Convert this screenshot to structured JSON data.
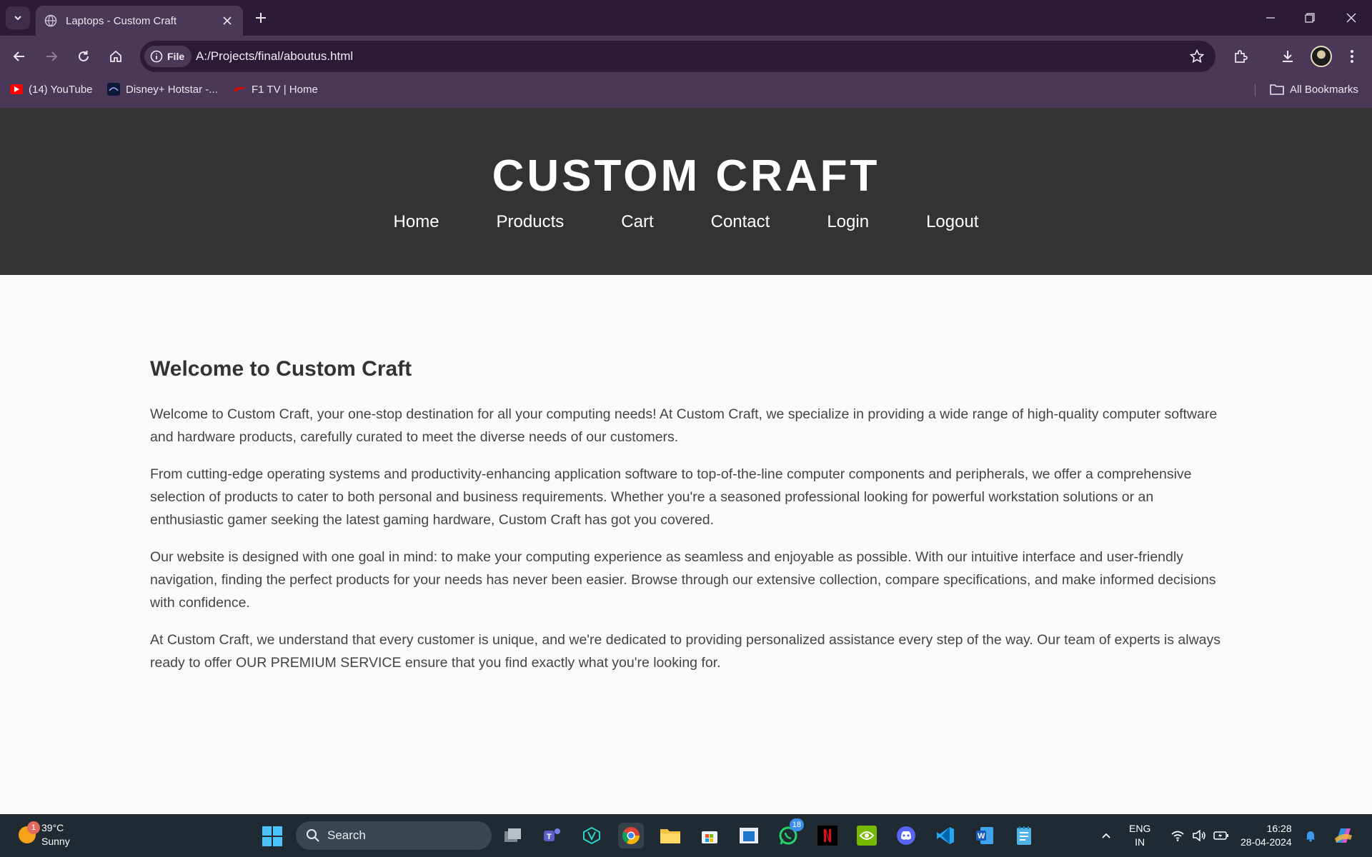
{
  "browser": {
    "tab_title": "Laptops - Custom Craft",
    "file_chip": "File",
    "url": "A:/Projects/final/aboutus.html",
    "bookmarks": [
      {
        "label": "(14) YouTube",
        "icon": "youtube-icon"
      },
      {
        "label": "Disney+ Hotstar -...",
        "icon": "hotstar-icon"
      },
      {
        "label": "F1 TV | Home",
        "icon": "f1-icon"
      }
    ],
    "all_bookmarks": "All Bookmarks"
  },
  "site": {
    "brand": "CUSTOM CRAFT",
    "nav": [
      "Home",
      "Products",
      "Cart",
      "Contact",
      "Login",
      "Logout"
    ]
  },
  "content": {
    "heading": "Welcome to Custom Craft",
    "paragraphs": [
      "Welcome to Custom Craft, your one-stop destination for all your computing needs! At Custom Craft, we specialize in providing a wide range of high-quality computer software and hardware products, carefully curated to meet the diverse needs of our customers.",
      "From cutting-edge operating systems and productivity-enhancing application software to top-of-the-line computer components and peripherals, we offer a comprehensive selection of products to cater to both personal and business requirements. Whether you're a seasoned professional looking for powerful workstation solutions or an enthusiastic gamer seeking the latest gaming hardware, Custom Craft has got you covered.",
      "Our website is designed with one goal in mind: to make your computing experience as seamless and enjoyable as possible. With our intuitive interface and user-friendly navigation, finding the perfect products for your needs has never been easier. Browse through our extensive collection, compare specifications, and make informed decisions with confidence.",
      "At Custom Craft, we understand that every customer is unique, and we're dedicated to providing personalized assistance every step of the way. Our team of experts is always ready to offer OUR PREMIUM SERVICE ensure that you find exactly what you're looking for."
    ]
  },
  "taskbar": {
    "weather_badge": "1",
    "temperature": "39°C",
    "condition": "Sunny",
    "search_placeholder": "Search",
    "whatsapp_badge": "18",
    "language": "ENG",
    "region": "IN",
    "time": "16:28",
    "date": "28-04-2024"
  },
  "colors": {
    "chrome_dark": "#2b1b38",
    "chrome_light": "#4a3858",
    "site_header": "#333333",
    "page_bg": "#fafafa",
    "taskbar": "#1f2a33"
  }
}
